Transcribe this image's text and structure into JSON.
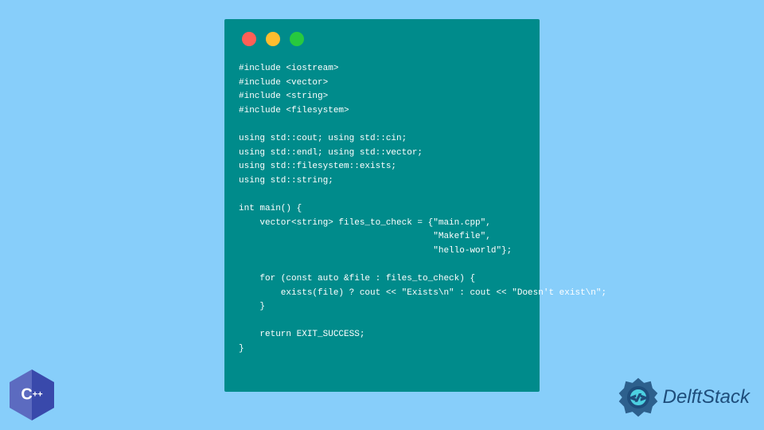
{
  "code": {
    "lines": [
      "#include <iostream>",
      "#include <vector>",
      "#include <string>",
      "#include <filesystem>",
      "",
      "using std::cout; using std::cin;",
      "using std::endl; using std::vector;",
      "using std::filesystem::exists;",
      "using std::string;",
      "",
      "int main() {",
      "    vector<string> files_to_check = {\"main.cpp\",",
      "                                     \"Makefile\",",
      "                                     \"hello-world\"};",
      "",
      "    for (const auto &file : files_to_check) {",
      "        exists(file) ? cout << \"Exists\\n\" : cout << \"Doesn't exist\\n\";",
      "    }",
      "",
      "    return EXIT_SUCCESS;",
      "}"
    ]
  },
  "badge": {
    "letter": "C",
    "plus": "++"
  },
  "brand": {
    "name": "DelftStack"
  }
}
